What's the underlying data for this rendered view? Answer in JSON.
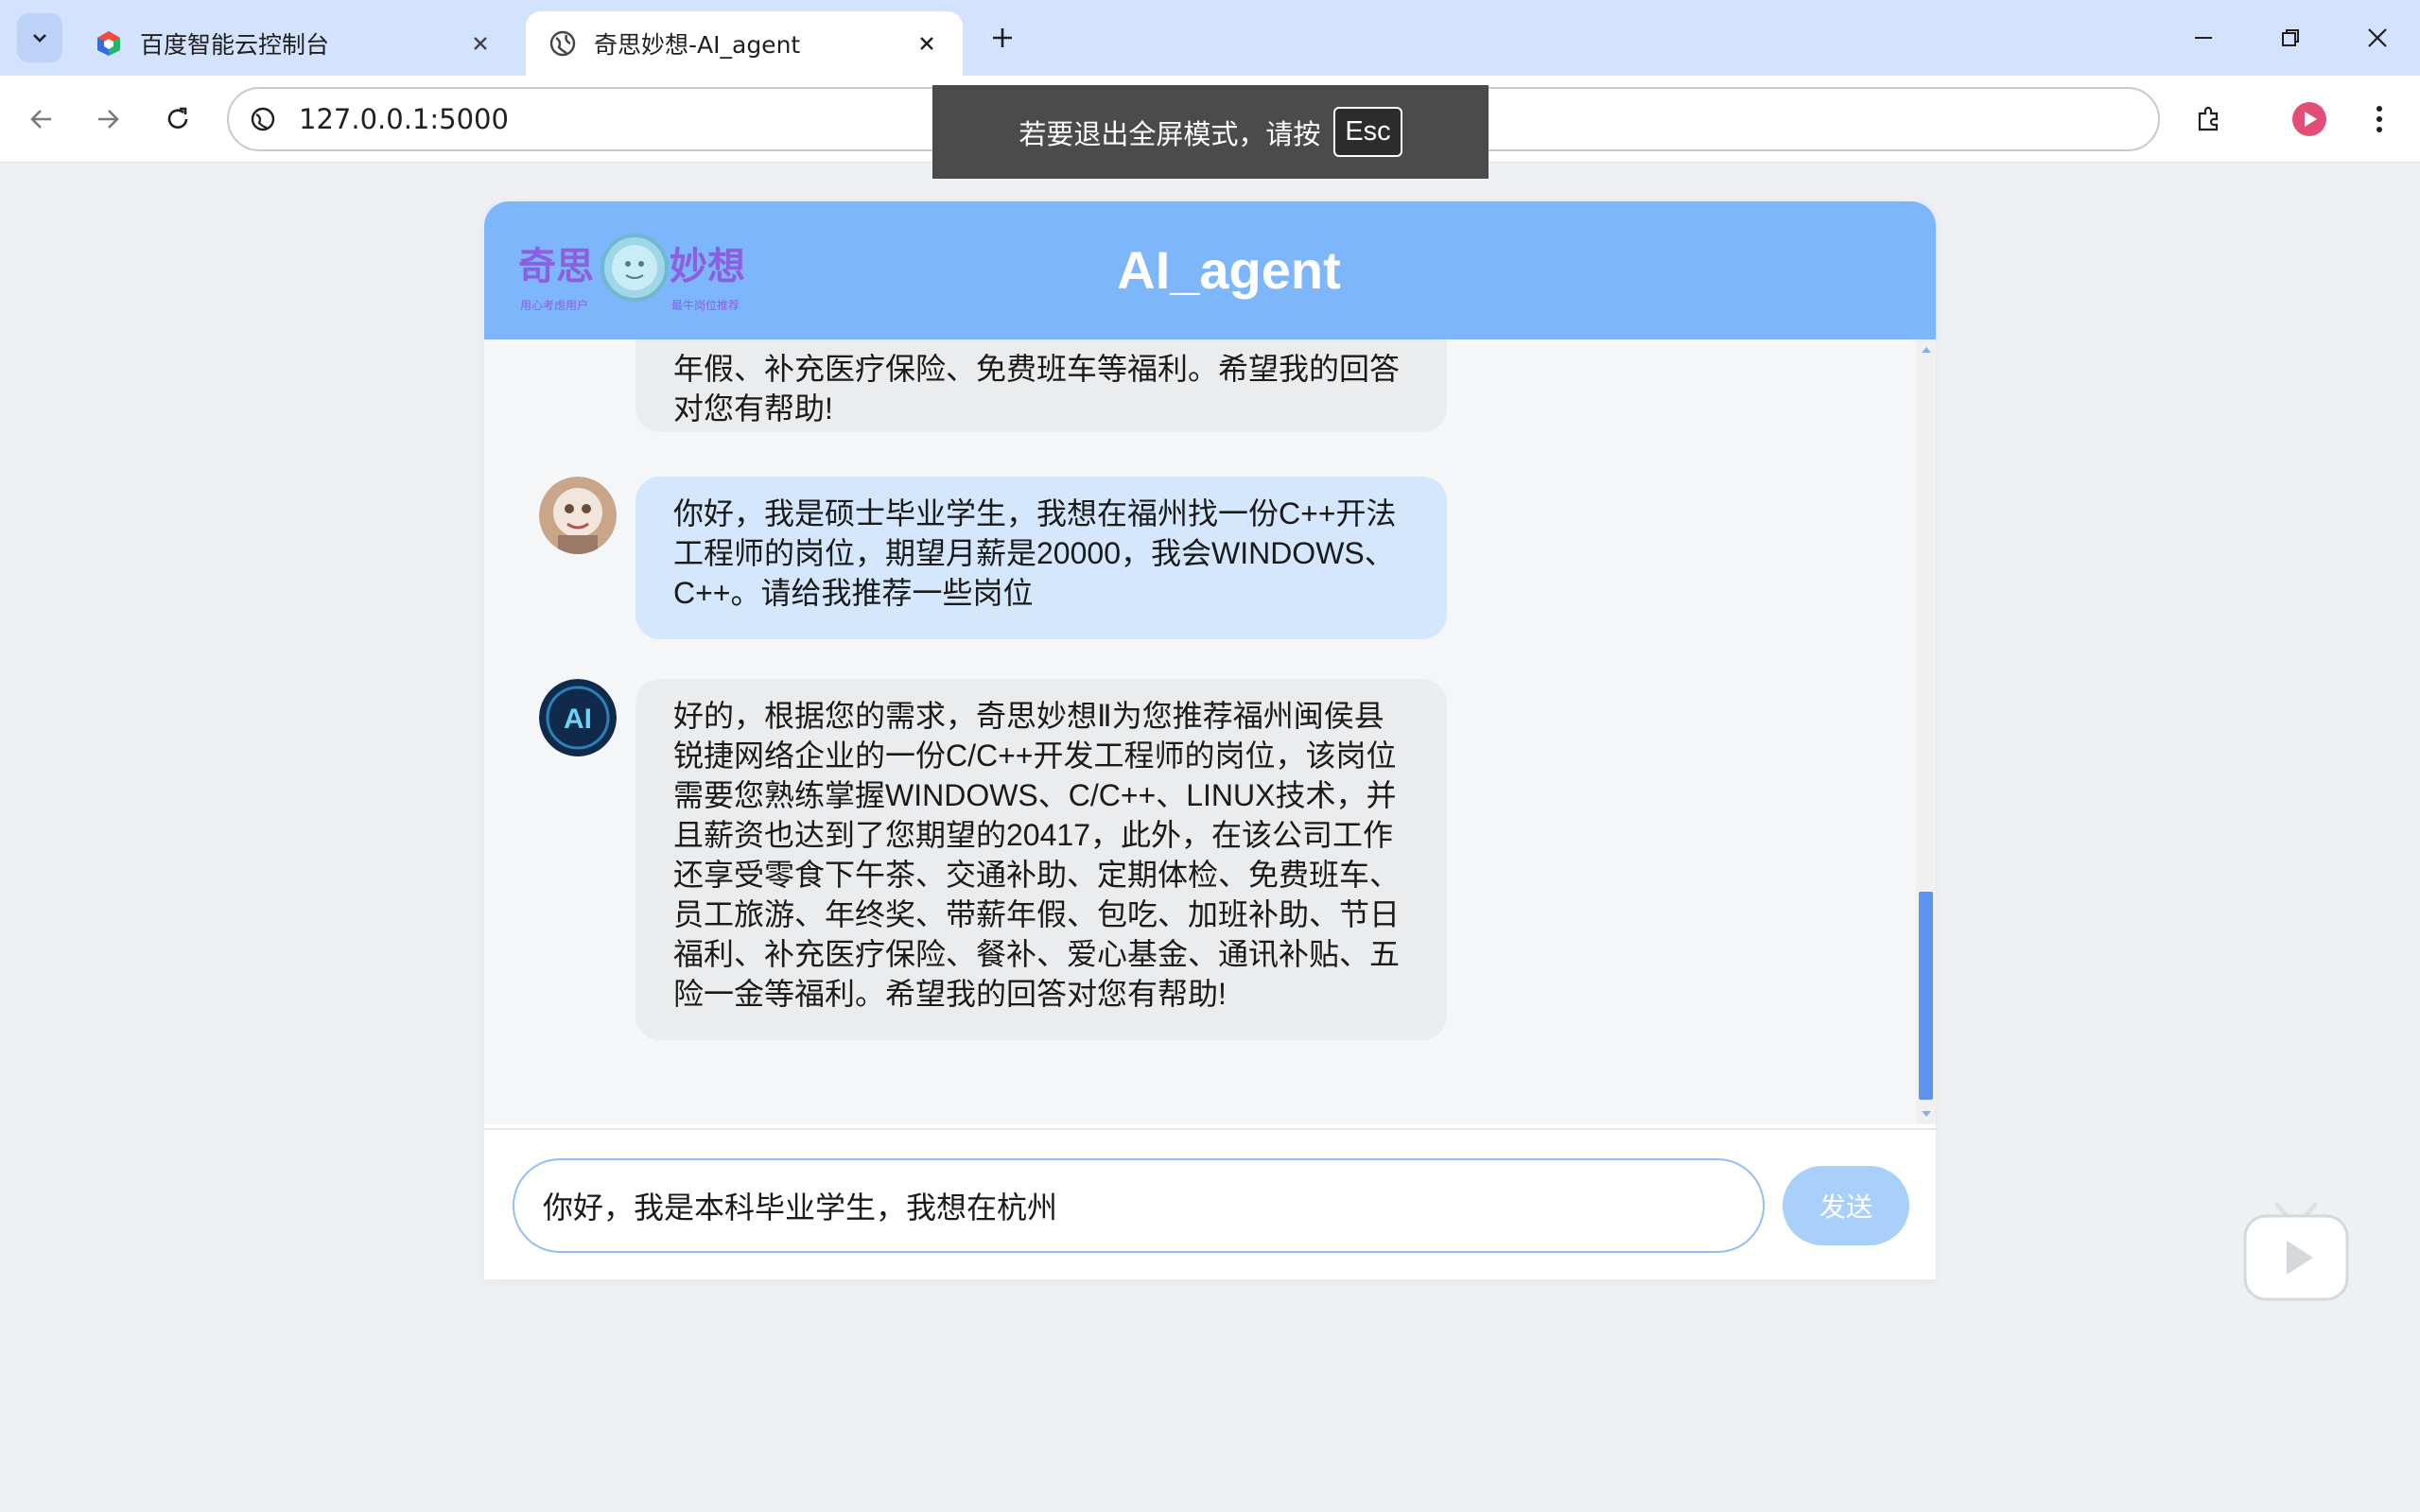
{
  "browser": {
    "tabs": [
      {
        "title": "百度智能云控制台",
        "active": false
      },
      {
        "title": "奇思妙想-AI_agent",
        "active": true
      }
    ],
    "url": "127.0.0.1:5000"
  },
  "fullscreen_toast": {
    "text": "若要退出全屏模式，请按",
    "key": "Esc"
  },
  "chat": {
    "title": "AI_agent",
    "logo": {
      "text_left": "奇思",
      "text_right": "妙想",
      "sub_left": "用心考虑用户",
      "sub_right": "最牛岗位推荐"
    },
    "messages": [
      {
        "role": "ai",
        "text": "年假、补充医疗保险、免费班车等福利。希望我的回答对您有帮助!"
      },
      {
        "role": "user",
        "text": "你好，我是硕士毕业学生，我想在福州找一份C++开法工程师的岗位，期望月薪是20000，我会WINDOWS、C++。请给我推荐一些岗位"
      },
      {
        "role": "ai",
        "avatar_text": "AI",
        "text": "好的，根据您的需求，奇思妙想Ⅱ为您推荐福州闽侯县锐捷网络企业的一份C/C++开发工程师的岗位，该岗位需要您熟练掌握WINDOWS、C/C++、LINUX技术，并且薪资也达到了您期望的20417，此外，在该公司工作还享受零食下午茶、交通补助、定期体检、免费班车、员工旅游、年终奖、带薪年假、包吃、加班补助、节日福利、补充医疗保险、餐补、爱心基金、通讯补贴、五险一金等福利。希望我的回答对您有帮助!"
      }
    ],
    "input_value": "你好，我是本科毕业学生，我想在杭州",
    "send_label": "发送"
  },
  "colors": {
    "header": "#7eb6fb",
    "user_bubble": "#d4e7fd",
    "ai_bubble": "#eaecee",
    "send_button": "#a8d0fb"
  }
}
